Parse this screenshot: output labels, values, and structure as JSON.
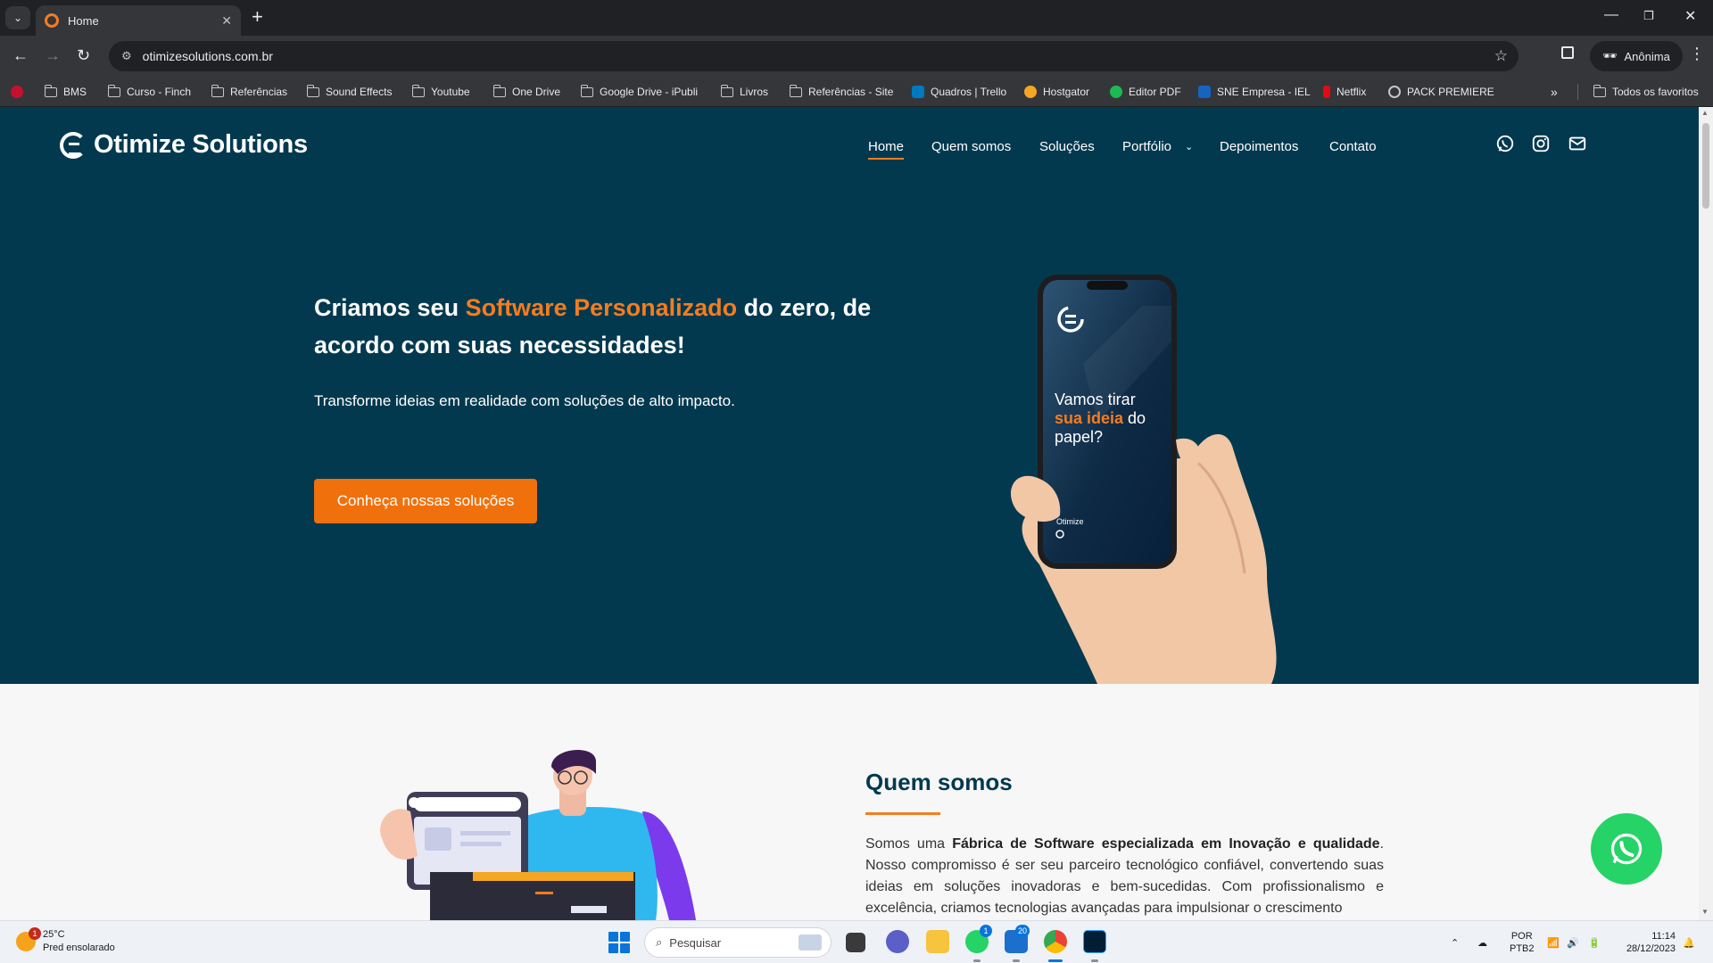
{
  "browser": {
    "tab_title": "Home",
    "url": "otimizesolutions.com.br",
    "profile_label": "Anônima",
    "bookmarks": [
      {
        "label": "BMS",
        "icon": "folder-icon"
      },
      {
        "label": "Curso - Finch",
        "icon": "folder-icon"
      },
      {
        "label": "Referências",
        "icon": "folder-icon"
      },
      {
        "label": "Sound Effects",
        "icon": "folder-icon"
      },
      {
        "label": "Youtube",
        "icon": "folder-icon"
      },
      {
        "label": "One Drive",
        "icon": "folder-icon"
      },
      {
        "label": "Google Drive - iPubli",
        "icon": "folder-icon"
      },
      {
        "label": "Livros",
        "icon": "folder-icon"
      },
      {
        "label": "Referências - Site",
        "icon": "folder-icon"
      },
      {
        "label": "Quadros | Trello",
        "icon": "trello-icon"
      },
      {
        "label": "Hostgator",
        "icon": "hostgator-icon"
      },
      {
        "label": "Editor PDF",
        "icon": "pdf-editor-icon"
      },
      {
        "label": "SNE Empresa - IEL",
        "icon": "sne-icon"
      },
      {
        "label": "Netflix",
        "icon": "netflix-icon"
      },
      {
        "label": "PACK PREMIERE",
        "icon": "globe-icon"
      }
    ],
    "all_bookmarks_label": "Todos os favoritos"
  },
  "site": {
    "brand": "Otimize Solutions",
    "nav": [
      "Home",
      "Quem somos",
      "Soluções",
      "Portfólio",
      "Depoimentos",
      "Contato"
    ],
    "active_nav": "Home",
    "hero": {
      "headline_pre": "Criamos seu ",
      "headline_highlight": "Software Personalizado",
      "headline_post": " do zero, de acordo com suas necessidades!",
      "subline": "Transforme ideias em realidade com soluções de alto impacto.",
      "cta_label": "Conheça nossas soluções",
      "phone_line1": "Vamos tirar",
      "phone_highlight": "sua ideia",
      "phone_line2": " do",
      "phone_line3": "papel?",
      "phone_brand": "Otimize"
    },
    "about": {
      "title": "Quem somos",
      "text_pre": "Somos uma ",
      "text_bold": "Fábrica de Software especializada em Inovação e qualidade",
      "text_post": ". Nosso compromisso é ser seu parceiro tecnológico confiável, convertendo suas ideias em soluções inovadoras e bem-sucedidas. Com profissionalismo e excelência, criamos tecnologias avançadas para impulsionar o crescimento"
    },
    "colors": {
      "primary": "#03394f",
      "accent": "#f47c20",
      "whatsapp": "#25d366"
    }
  },
  "taskbar": {
    "weather_temp": "25°C",
    "weather_desc": "Pred ensolarado",
    "weather_badge": "1",
    "search_placeholder": "Pesquisar",
    "whatsapp_badge": "1",
    "teams_badge": "20",
    "lang_line1": "POR",
    "lang_line2": "PTB2",
    "time": "11:14",
    "date": "28/12/2023"
  }
}
